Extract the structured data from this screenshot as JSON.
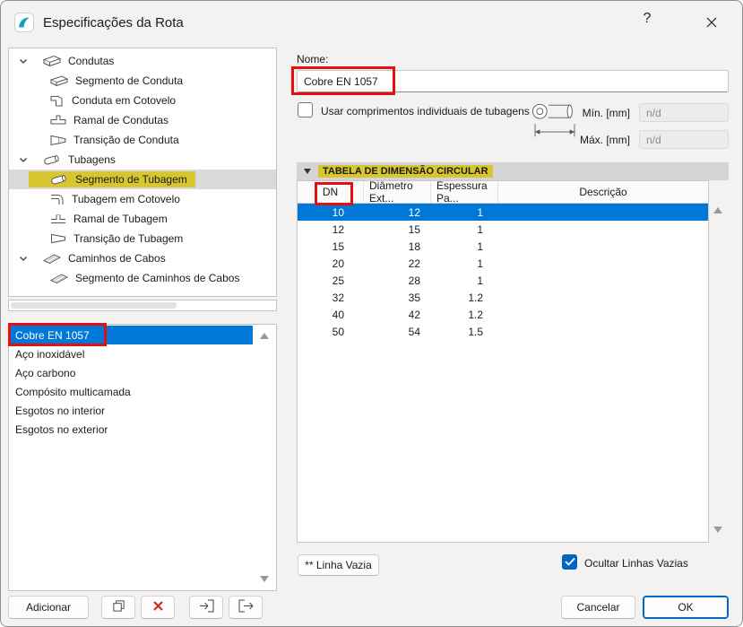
{
  "colors": {
    "selection_blue": "#0078d7",
    "accent_blue": "#0067c0",
    "annotation_red": "#e60f0f",
    "highlight_yellow": "#d7c630",
    "brand_teal": "#14a0c4"
  },
  "window": {
    "title": "Especificações da Rota",
    "help_label": "?"
  },
  "tree": {
    "items": [
      {
        "label": "Condutas",
        "level": 0,
        "expanded": true
      },
      {
        "label": "Segmento de Conduta",
        "level": 1
      },
      {
        "label": "Conduta em Cotovelo",
        "level": 1
      },
      {
        "label": "Ramal de Condutas",
        "level": 1
      },
      {
        "label": "Transição de Conduta",
        "level": 1
      },
      {
        "label": "Tubagens",
        "level": 0,
        "expanded": true
      },
      {
        "label": "Segmento de Tubagem",
        "level": 1,
        "selected": true,
        "highlighted": true
      },
      {
        "label": "Tubagem em Cotovelo",
        "level": 1
      },
      {
        "label": "Ramal de Tubagem",
        "level": 1
      },
      {
        "label": "Transição de Tubagem",
        "level": 1
      },
      {
        "label": "Caminhos de Cabos",
        "level": 0,
        "expanded": true
      },
      {
        "label": "Segmento de Caminhos de Cabos",
        "level": 1
      }
    ]
  },
  "list": {
    "items": [
      {
        "label": "Cobre EN 1057",
        "selected": true,
        "annotated": true
      },
      {
        "label": "Aço inoxidável"
      },
      {
        "label": "Aço carbono"
      },
      {
        "label": "Compósito multicamada"
      },
      {
        "label": "Esgotos no interior"
      },
      {
        "label": "Esgotos no exterior"
      }
    ]
  },
  "toolbar": {
    "add_label": "Adicionar"
  },
  "form": {
    "name_label": "Nome:",
    "name_value": "Cobre EN 1057",
    "individual_lengths_label": "Usar comprimentos individuais de tubagens",
    "individual_lengths_checked": false,
    "min_label": "Mín. [mm]",
    "min_value": "n/d",
    "max_label": "Máx. [mm]",
    "max_value": "n/d"
  },
  "table_section": {
    "title": "TABELA DE DIMENSÃO CIRCULAR",
    "columns": [
      "DN",
      "Diâmetro Ext...",
      "Espessura Pa...",
      "Descrição"
    ],
    "rows": [
      {
        "dn": "10",
        "diametro": "12",
        "espessura": "1",
        "descricao": "",
        "selected": true
      },
      {
        "dn": "12",
        "diametro": "15",
        "espessura": "1",
        "descricao": ""
      },
      {
        "dn": "15",
        "diametro": "18",
        "espessura": "1",
        "descricao": ""
      },
      {
        "dn": "20",
        "diametro": "22",
        "espessura": "1",
        "descricao": ""
      },
      {
        "dn": "25",
        "diametro": "28",
        "espessura": "1",
        "descricao": ""
      },
      {
        "dn": "32",
        "diametro": "35",
        "espessura": "1.2",
        "descricao": ""
      },
      {
        "dn": "40",
        "diametro": "42",
        "espessura": "1.2",
        "descricao": ""
      },
      {
        "dn": "50",
        "diametro": "54",
        "espessura": "1.5",
        "descricao": ""
      }
    ],
    "empty_line_button": "** Linha Vazia",
    "hide_empty_label": "Ocultar Linhas Vazias",
    "hide_empty_checked": true
  },
  "footer": {
    "cancel_label": "Cancelar",
    "ok_label": "OK"
  }
}
